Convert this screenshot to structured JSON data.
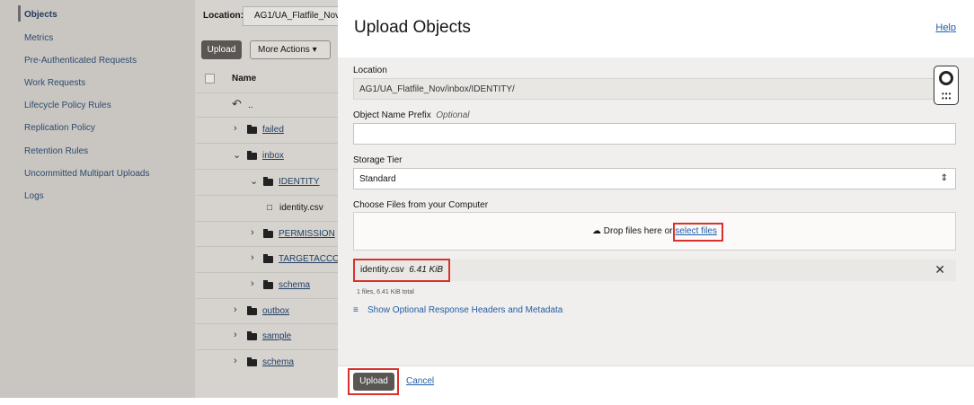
{
  "sidebar": {
    "items": [
      {
        "label": "Objects",
        "active": true
      },
      {
        "label": "Metrics"
      },
      {
        "label": "Pre-Authenticated Requests"
      },
      {
        "label": "Work Requests"
      },
      {
        "label": "Lifecycle Policy Rules"
      },
      {
        "label": "Replication Policy"
      },
      {
        "label": "Retention Rules"
      },
      {
        "label": "Uncommitted Multipart Uploads"
      },
      {
        "label": "Logs"
      }
    ]
  },
  "objects": {
    "location_label": "Location:",
    "location_value": "AG1/UA_Flatfile_Nov",
    "upload_btn": "Upload",
    "more_actions": "More Actions",
    "name_header": "Name",
    "up_dir": "..",
    "rows": [
      {
        "label": "failed"
      },
      {
        "label": "inbox"
      },
      {
        "label": "IDENTITY"
      },
      {
        "label": "identity.csv"
      },
      {
        "label": "PERMISSION"
      },
      {
        "label": "TARGETACCO"
      },
      {
        "label": "schema"
      },
      {
        "label": "outbox"
      },
      {
        "label": "sample"
      },
      {
        "label": "schema"
      }
    ]
  },
  "panel": {
    "title": "Upload Objects",
    "help": "Help",
    "location_label": "Location",
    "location_value": "AG1/UA_Flatfile_Nov/inbox/IDENTITY/",
    "prefix_label": "Object Name Prefix",
    "prefix_optional": "Optional",
    "prefix_value": "",
    "tier_label": "Storage Tier",
    "tier_value": "Standard",
    "choose_label": "Choose Files from your Computer",
    "drop_text": "Drop files here or",
    "select_files": "select files",
    "file_name": "identity.csv",
    "file_size": "6.41 KiB",
    "total": "1 files, 6.41 KiB total",
    "optional_headers": "Show Optional Response Headers and Metadata",
    "upload": "Upload",
    "cancel": "Cancel"
  },
  "colors": {
    "accent": "#1f5ea8",
    "highlight": "#d9312b",
    "primary_button": "#5a5652"
  }
}
